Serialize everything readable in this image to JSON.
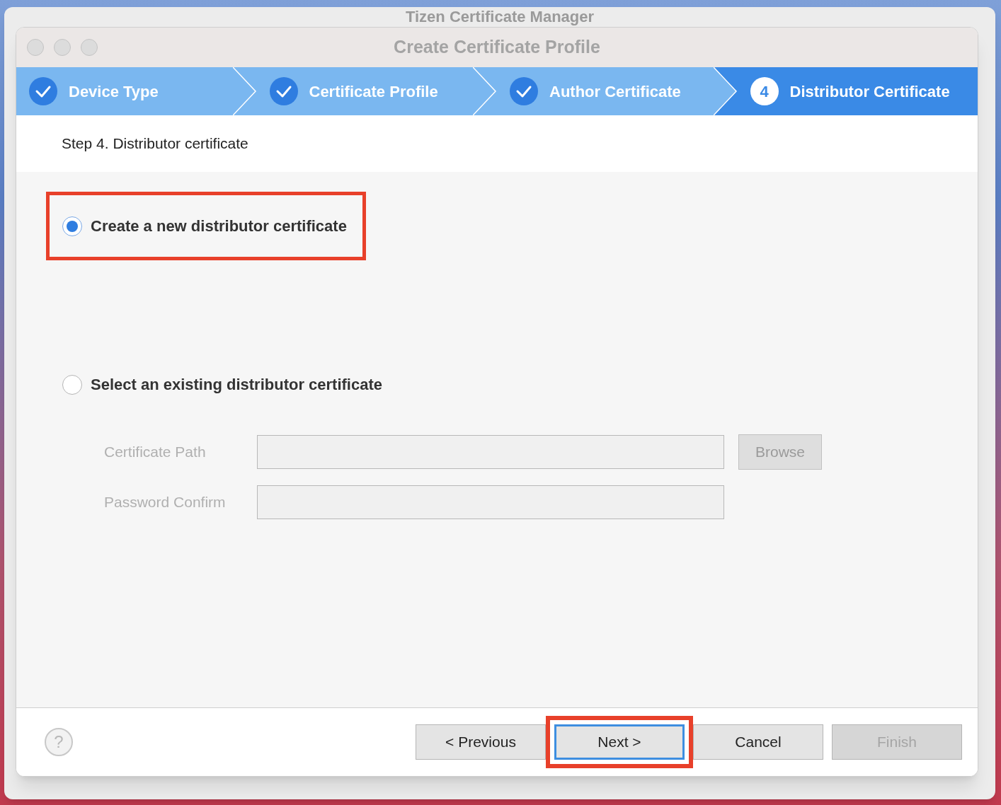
{
  "parent_window": {
    "title": "Tizen Certificate Manager"
  },
  "dialog": {
    "title": "Create Certificate Profile"
  },
  "steps": [
    {
      "label": "Device Type",
      "completed": true,
      "selected": false
    },
    {
      "label": "Certificate Profile",
      "completed": true,
      "selected": false
    },
    {
      "label": "Author Certificate",
      "completed": true,
      "selected": false
    },
    {
      "label": "Distributor Certificate",
      "completed": false,
      "selected": true,
      "number": "4"
    }
  ],
  "step_heading": "Step 4. Distributor certificate",
  "options": [
    {
      "label": "Create a new distributor certificate",
      "selected": true,
      "highlighted": true
    },
    {
      "label": "Select an existing distributor certificate",
      "selected": false,
      "highlighted": false
    }
  ],
  "fields": [
    {
      "label": "Certificate Path",
      "disabled": true,
      "button": "Browse"
    },
    {
      "label": "Password Confirm",
      "disabled": true
    }
  ],
  "help": "?",
  "buttons": [
    {
      "label": "< Previous",
      "disabled": false,
      "focused": false,
      "highlighted": false
    },
    {
      "label": "Next >",
      "disabled": false,
      "focused": true,
      "highlighted": true
    },
    {
      "label": "Cancel",
      "disabled": false,
      "focused": false,
      "highlighted": false
    },
    {
      "label": "Finish",
      "disabled": true,
      "focused": false,
      "highlighted": false
    }
  ]
}
